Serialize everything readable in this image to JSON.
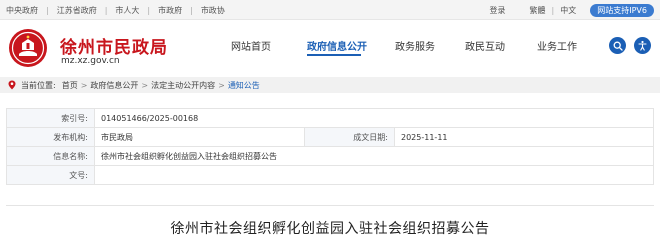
{
  "topbar": {
    "links": [
      "中央政府",
      "江苏省政府",
      "市人大",
      "市政府",
      "市政协"
    ],
    "login": "登录",
    "font_mode": "繁體",
    "lang": "中文",
    "ipv6": "网站支持IPV6"
  },
  "header": {
    "site_title": "徐州市民政局",
    "site_domain": "mz.xz.gov.cn",
    "nav": [
      "网站首页",
      "政府信息公开",
      "政务服务",
      "政民互动",
      "业务工作"
    ],
    "active_nav_index": 1,
    "accent_color": "#1b5fb5",
    "brand_color": "#c8161d"
  },
  "breadcrumb": {
    "prefix": "当前位置:",
    "items": [
      "首页",
      "政府信息公开",
      "法定主动公开内容",
      "通知公告"
    ],
    "separator": ">"
  },
  "info": {
    "index_label": "索引号:",
    "index_value": "014051466/2025-00168",
    "org_label": "发布机构:",
    "org_value": "市民政局",
    "date_label": "成文日期:",
    "date_value": "2025-11-11",
    "name_label": "信息名称:",
    "name_value": "徐州市社会组织孵化创益园入驻社会组织招募公告",
    "doc_label": "文号:",
    "doc_value": ""
  },
  "article": {
    "title": "徐州市社会组织孵化创益园入驻社会组织招募公告"
  }
}
